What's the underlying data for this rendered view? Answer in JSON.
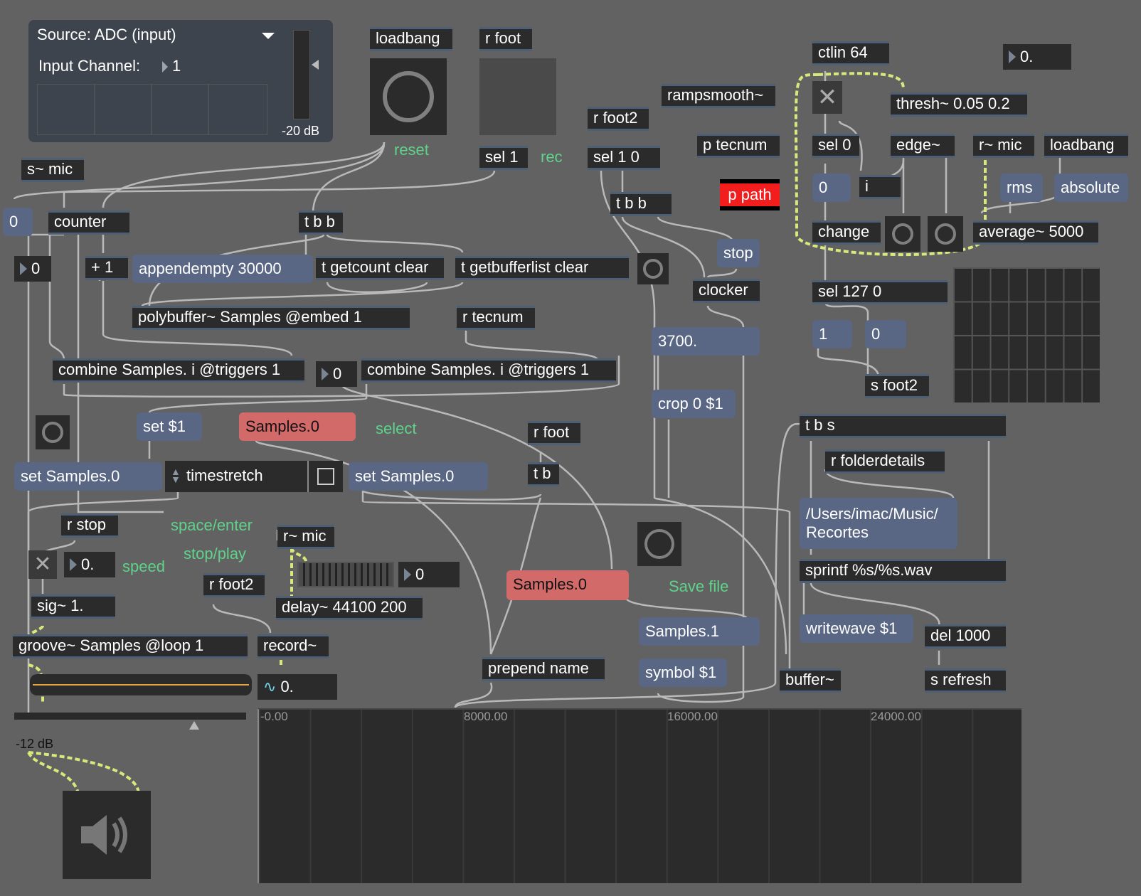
{
  "adc": {
    "source_label": "Source: ADC (input)",
    "channel_label": "Input Channel:",
    "channel_value": "1",
    "db_label": "-20 dB"
  },
  "objects": {
    "loadbang_1": "loadbang",
    "r_foot_1": "r foot",
    "s_mic": "s~ mic",
    "counter": "counter",
    "plus_one": "+ 1",
    "t_b_b_1": "t b b",
    "t_getcount": "t getcount clear",
    "t_getbufferlist": "t getbufferlist clear",
    "polybuffer": "polybuffer~ Samples @embed 1",
    "r_tecnum": "r tecnum",
    "combine_1": "combine Samples. i @triggers 1",
    "combine_2": "combine Samples. i @triggers 1",
    "sel_1": "sel 1",
    "r_foot2_1": "r foot2",
    "sel_1_0": "sel 1 0",
    "t_b_b_2": "t b b",
    "rampsmooth": "rampsmooth~",
    "p_tecnum": "p tecnum",
    "p_path": "p path",
    "clocker": "clocker",
    "ctlin": "ctlin 64",
    "thresh": "thresh~ 0.05 0.2",
    "sel_0": "sel 0",
    "edge": "edge~",
    "r_mic_1": "r~ mic",
    "loadbang_2": "loadbang",
    "i_obj": "i",
    "change": "change",
    "average": "average~ 5000",
    "sel_127_0": "sel 127 0",
    "s_foot2": "s foot2",
    "r_foot_2": "r foot",
    "t_b": "t b",
    "t_b_s": "t b s",
    "r_folderdetails": "r folderdetails",
    "sprintf": "sprintf %s/%s.wav",
    "del_1000": "del 1000",
    "s_refresh": "s refresh",
    "buffer": "buffer~",
    "r_stop": "r stop",
    "r_mic_2": "r~ mic",
    "r_foot2_2": "r foot2",
    "delay": "delay~ 44100 200",
    "sig": "sig~ 1.",
    "groove": "groove~ Samples @loop 1",
    "record": "record~",
    "prepend": "prepend name"
  },
  "messages": {
    "appendempty": "appendempty 30000",
    "stop": "stop",
    "set_dollar1": "set $1",
    "samples0_sel": "Samples.0",
    "set_samples_1": "set Samples.0",
    "set_samples_2": "set Samples.0",
    "samples0_save": "Samples.0",
    "samples1": "Samples.1",
    "symbol": "symbol $1",
    "crop": "crop 0 $1",
    "clock_val": "3700.",
    "msg_0": "0",
    "msg_1": "1",
    "msg_0b": "0",
    "rms": "rms",
    "absolute": "absolute",
    "path": "/Users/imac/Music/\nRecortes",
    "writewave": "writewave $1"
  },
  "numbers": {
    "num_left": "0",
    "num_counter": "0",
    "num_combine": "0",
    "num_thresh": "0.",
    "num_speed": "0.",
    "num_delay": "0",
    "num_signal": "0."
  },
  "menus": {
    "timestretch": "timestretch"
  },
  "comments": {
    "reset": "reset",
    "rec": "rec",
    "select": "select",
    "space_enter": "space/enter",
    "stop_play": "stop/play",
    "speed": "speed",
    "save_file": "Save file"
  },
  "slider": {
    "db_label": "-12 dB"
  },
  "waveform": {
    "ticks": [
      "-0.00",
      "8000.00",
      "16000.00",
      "24000.00"
    ]
  },
  "colors": {
    "background": "#626262",
    "object": "#2b2b2b",
    "message": "#596684",
    "red_message": "#d36a6a",
    "comment": "#5fd38a",
    "signal_cable": "#d8e87a"
  }
}
